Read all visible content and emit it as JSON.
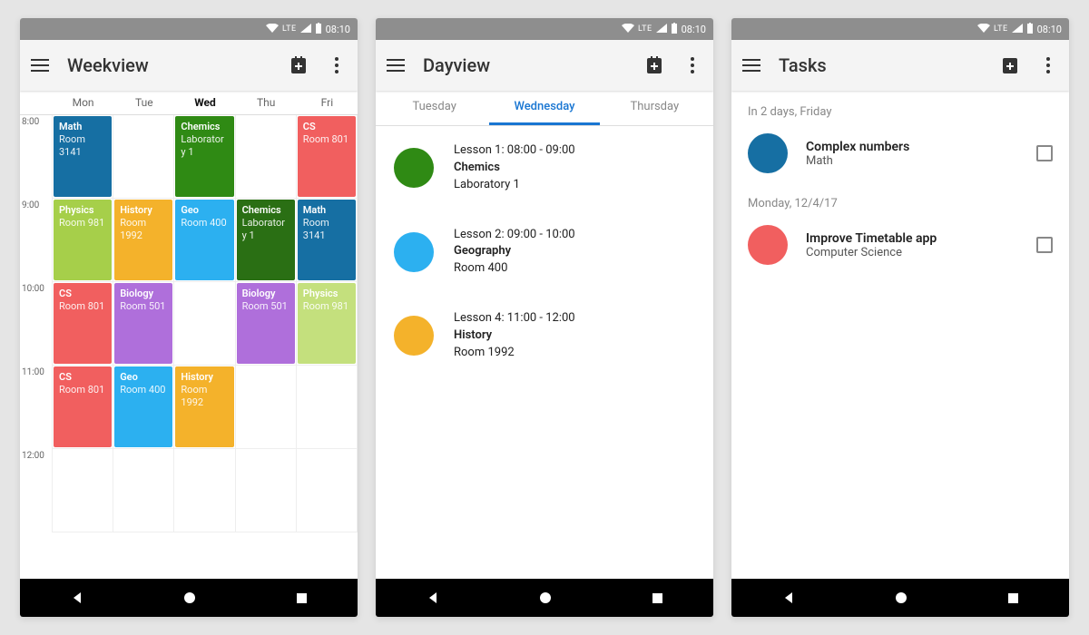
{
  "statusbar": {
    "lte": "LTE",
    "time": "08:10"
  },
  "colors": {
    "blue": "#0d5e9f",
    "green": "#2f8a14",
    "red": "#f15f5f",
    "lime": "#a6cf4a",
    "orange": "#f4b22b",
    "sky": "#2cb0f0",
    "purple": "#af6fdb",
    "pale": "#c4e07d",
    "darkgreen": "#2a6f14",
    "teal": "#166fa3"
  },
  "weekview": {
    "title": "Weekview",
    "days": [
      "Mon",
      "Tue",
      "Wed",
      "Thu",
      "Fri"
    ],
    "active_day_index": 2,
    "hours": [
      "8:00",
      "9:00",
      "10:00",
      "11:00",
      "12:00"
    ],
    "events": [
      {
        "day": 0,
        "hour": 0,
        "subject": "Math",
        "location": "Room 3141",
        "color": "teal"
      },
      {
        "day": 2,
        "hour": 0,
        "subject": "Chemics",
        "location": "Laboratory 1",
        "color": "green"
      },
      {
        "day": 4,
        "hour": 0,
        "subject": "CS",
        "location": "Room 801",
        "color": "red"
      },
      {
        "day": 0,
        "hour": 1,
        "subject": "Physics",
        "location": "Room 981",
        "color": "lime"
      },
      {
        "day": 1,
        "hour": 1,
        "subject": "History",
        "location": "Room 1992",
        "color": "orange"
      },
      {
        "day": 2,
        "hour": 1,
        "subject": "Geo",
        "location": "Room 400",
        "color": "sky"
      },
      {
        "day": 3,
        "hour": 1,
        "subject": "Chemics",
        "location": "Laboratory 1",
        "color": "darkgreen"
      },
      {
        "day": 4,
        "hour": 1,
        "subject": "Math",
        "location": "Room 3141",
        "color": "teal"
      },
      {
        "day": 0,
        "hour": 2,
        "subject": "CS",
        "location": "Room 801",
        "color": "red"
      },
      {
        "day": 1,
        "hour": 2,
        "subject": "Biology",
        "location": "Room 501",
        "color": "purple"
      },
      {
        "day": 3,
        "hour": 2,
        "subject": "Biology",
        "location": "Room 501",
        "color": "purple"
      },
      {
        "day": 4,
        "hour": 2,
        "subject": "Physics",
        "location": "Room 981",
        "color": "pale"
      },
      {
        "day": 0,
        "hour": 3,
        "subject": "CS",
        "location": "Room 801",
        "color": "red"
      },
      {
        "day": 1,
        "hour": 3,
        "subject": "Geo",
        "location": "Room 400",
        "color": "sky"
      },
      {
        "day": 2,
        "hour": 3,
        "subject": "History",
        "location": "Room 1992",
        "color": "orange"
      }
    ]
  },
  "dayview": {
    "title": "Dayview",
    "tabs": [
      "Tuesday",
      "Wednesday",
      "Thursday"
    ],
    "active_tab_index": 1,
    "lessons": [
      {
        "header": "Lesson 1: 08:00 - 09:00",
        "subject": "Chemics",
        "location": "Laboratory 1",
        "color": "green"
      },
      {
        "header": "Lesson 2: 09:00 - 10:00",
        "subject": "Geography",
        "location": "Room 400",
        "color": "sky"
      },
      {
        "header": "Lesson 4: 11:00 - 12:00",
        "subject": "History",
        "location": "Room 1992",
        "color": "orange"
      }
    ]
  },
  "tasks": {
    "title": "Tasks",
    "sections": [
      {
        "label": "In 2 days, Friday",
        "items": [
          {
            "title": "Complex numbers",
            "subject": "Math",
            "color": "teal",
            "checked": false
          }
        ]
      },
      {
        "label": "Monday, 12/4/17",
        "items": [
          {
            "title": "Improve Timetable app",
            "subject": "Computer Science",
            "color": "red",
            "checked": false
          }
        ]
      }
    ]
  }
}
